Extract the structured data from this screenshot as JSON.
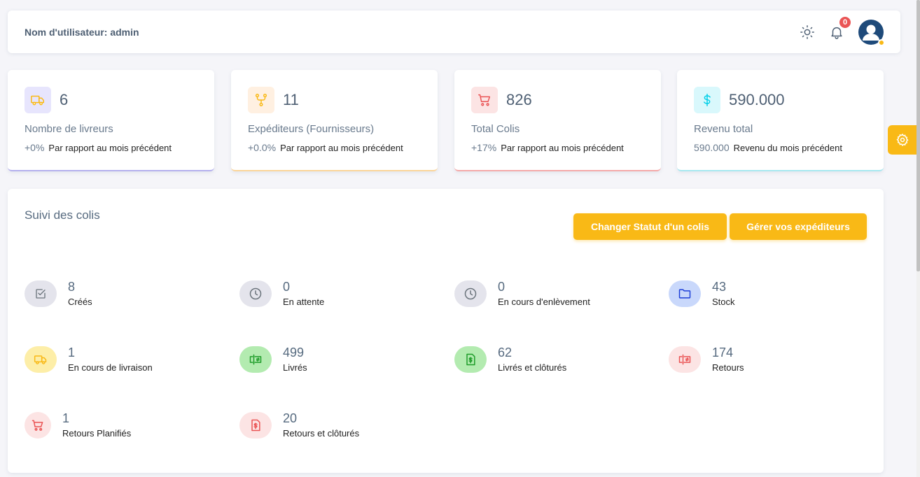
{
  "navbar": {
    "user_label": "Nom d'utilisateur: admin",
    "notification_count": "0"
  },
  "stats": [
    {
      "value": "6",
      "label": "Nombre de livreurs",
      "pct": "+0%",
      "compare": "Par rapport au mois précédent",
      "icon": "truck-icon",
      "color": "#7367f0"
    },
    {
      "value": "11",
      "label": "Expéditeurs (Fournisseurs)",
      "pct": "+0.0%",
      "compare": "Par rapport au mois précédent",
      "icon": "fork-icon",
      "color": "#ff9f43"
    },
    {
      "value": "826",
      "label": "Total Colis",
      "pct": "+17%",
      "compare": "Par rapport au mois précédent",
      "icon": "cart-icon",
      "color": "#ea5455"
    },
    {
      "value": "590.000",
      "label": "Revenu total",
      "pct": "590.000",
      "compare": "Revenu du mois précédent",
      "icon": "dollar-icon",
      "color": "#00cfe8"
    }
  ],
  "tracking": {
    "title": "Suivi des colis",
    "btn_change_status": "Changer Statut d'un colis",
    "btn_manage_senders": "Gérer vos expéditeurs",
    "items": [
      {
        "value": "8",
        "label": "Créés",
        "icon": "checkbox-icon"
      },
      {
        "value": "0",
        "label": "En attente",
        "icon": "clock-icon"
      },
      {
        "value": "0",
        "label": "En cours d'enlèvement",
        "icon": "clock-icon"
      },
      {
        "value": "43",
        "label": "Stock",
        "icon": "folder-icon"
      },
      {
        "value": "1",
        "label": "En cours de livraison",
        "icon": "truck-icon"
      },
      {
        "value": "499",
        "label": "Livrés",
        "icon": "transfer-icon"
      },
      {
        "value": "62",
        "label": "Livrés et clôturés",
        "icon": "dollar-file-icon"
      },
      {
        "value": "174",
        "label": "Retours",
        "icon": "transfer-icon"
      },
      {
        "value": "1",
        "label": "Retours Planifiés",
        "icon": "cart-icon"
      },
      {
        "value": "20",
        "label": "Retours et clôturés",
        "icon": "dollar-file-icon"
      }
    ]
  },
  "colors": {
    "accent": "#f9b916",
    "background": "#f5f5f9",
    "badge": "#ea5455"
  }
}
